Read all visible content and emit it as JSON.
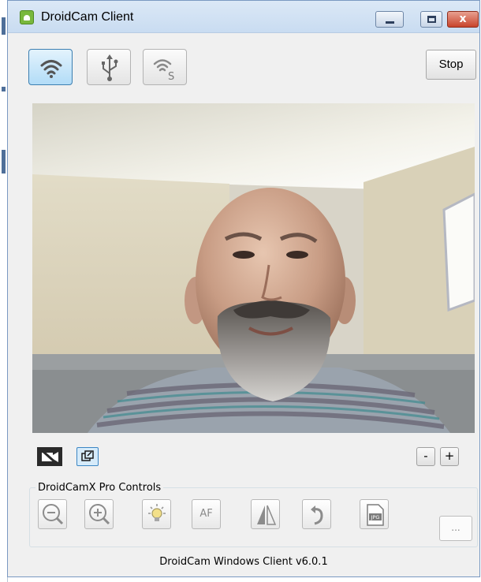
{
  "window": {
    "title": "DroidCam Client",
    "minimize_icon": "minimize-icon",
    "maximize_icon": "maximize-icon",
    "close_icon": "close-icon",
    "close_label": "x"
  },
  "toolbar": {
    "connection_buttons": [
      {
        "name": "wifi-button",
        "icon": "wifi-icon",
        "active": true
      },
      {
        "name": "usb-button",
        "icon": "usb-icon",
        "active": false
      },
      {
        "name": "wifi-server-button",
        "icon": "wifi-server-icon",
        "badge": "S",
        "active": false
      }
    ],
    "stop_label": "Stop"
  },
  "video": {
    "content": "webcam-preview"
  },
  "controls": {
    "camera_toggle_icon": "camera-off-icon",
    "popout_icon": "popout-window-icon",
    "zoom_out_label": "-",
    "zoom_in_label": "+"
  },
  "pro_controls": {
    "label": "DroidCamX Pro Controls",
    "af_label": "AF",
    "more_label": "...",
    "jpg_label": "JPG",
    "buttons": [
      {
        "name": "zoom-out-button",
        "icon": "zoom-out-icon"
      },
      {
        "name": "zoom-in-button",
        "icon": "zoom-in-icon"
      },
      {
        "name": "light-button",
        "icon": "lightbulb-icon"
      },
      {
        "name": "autofocus-button",
        "icon": "af-icon"
      },
      {
        "name": "mirror-button",
        "icon": "mirror-icon"
      },
      {
        "name": "rotate-button",
        "icon": "rotate-icon"
      },
      {
        "name": "jpg-button",
        "icon": "jpg-file-icon"
      }
    ]
  },
  "footer": {
    "version": "DroidCam Windows Client v6.0.1"
  },
  "colors": {
    "active_button": "#b2dcf7",
    "titlebar": "#c9dcf1",
    "close_button": "#c8442c",
    "background": "#f0f0f0"
  }
}
